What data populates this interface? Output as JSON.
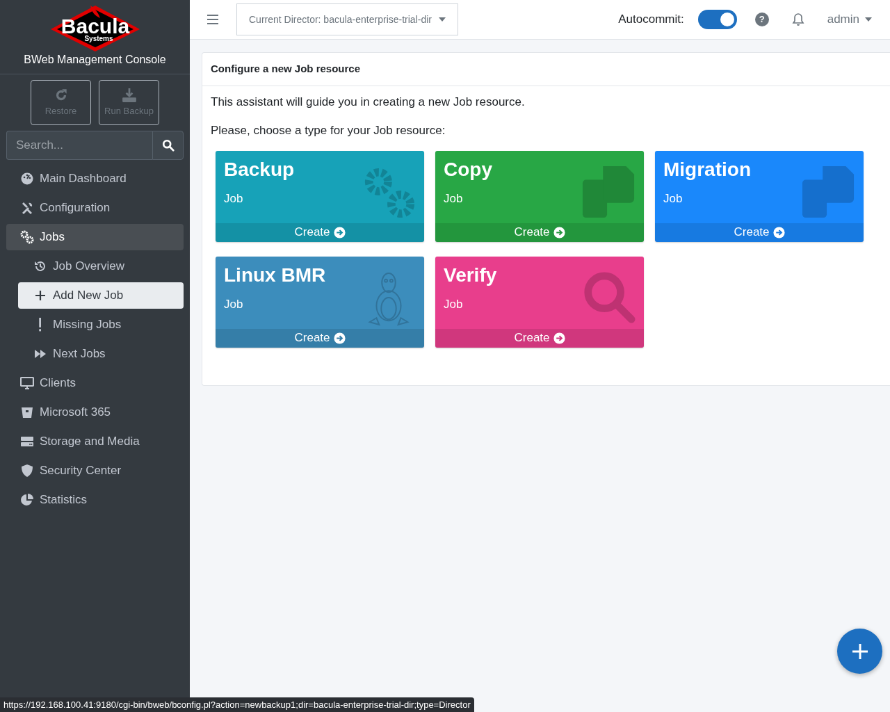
{
  "sidebar": {
    "logo": {
      "name": "Bacula",
      "subtitle": "Systems"
    },
    "title": "BWeb Management Console",
    "actions": [
      {
        "label": "Restore",
        "kind": "restore",
        "disabled": true
      },
      {
        "label": "Run Backup",
        "kind": "download",
        "disabled": true
      }
    ],
    "search": {
      "placeholder": "Search..."
    },
    "items": [
      {
        "label": "Main Dashboard",
        "kind": "dashboard",
        "selected": false
      },
      {
        "label": "Configuration",
        "kind": "tools",
        "selected": false
      },
      {
        "label": "Jobs",
        "kind": "gears",
        "selected": true,
        "children": [
          {
            "label": "Job Overview",
            "kind": "history",
            "selected": false
          },
          {
            "label": "Add New Job",
            "kind": "plus",
            "selected": true
          },
          {
            "label": "Missing Jobs",
            "kind": "exclamation",
            "selected": false
          },
          {
            "label": "Next Jobs",
            "kind": "forward",
            "selected": false
          }
        ]
      },
      {
        "label": "Clients",
        "kind": "desktop",
        "selected": false
      },
      {
        "label": "Microsoft 365",
        "kind": "bucket",
        "selected": false
      },
      {
        "label": "Storage and Media",
        "kind": "storage",
        "selected": false
      },
      {
        "label": "Security Center",
        "kind": "shield",
        "selected": false
      },
      {
        "label": "Statistics",
        "kind": "chart",
        "selected": false
      }
    ]
  },
  "header": {
    "director": "Current Director: bacula-enterprise-trial-dir",
    "autocommit": {
      "label": "Autocommit:",
      "on": true
    },
    "help": "?",
    "user": "admin"
  },
  "content": {
    "title": "Configure a new Job resource",
    "intro": "This assistant will guide you in creating a new Job resource.",
    "prompt": "Please, choose a type for your Job resource:",
    "tiles": [
      {
        "title": "Backup",
        "subtitle": "Job",
        "action": "Create",
        "kind": "gears",
        "color": "#17a2b8"
      },
      {
        "title": "Copy",
        "subtitle": "Job",
        "action": "Create",
        "kind": "copy",
        "color": "#28a745"
      },
      {
        "title": "Migration",
        "subtitle": "Job",
        "action": "Create",
        "kind": "copy",
        "color": "#1a88fb"
      },
      {
        "title": "Linux BMR",
        "subtitle": "Job",
        "action": "Create",
        "kind": "linux",
        "color": "#3c8dbc"
      },
      {
        "title": "Verify",
        "subtitle": "Job",
        "action": "Create",
        "kind": "search",
        "color": "#e83e8c"
      }
    ]
  },
  "status_bar": {
    "url": "https://192.168.100.41:9180/cgi-bin/bweb/bconfig.pl?action=newbackup1;dir=bacula-enterprise-trial-dir;type=Director"
  }
}
